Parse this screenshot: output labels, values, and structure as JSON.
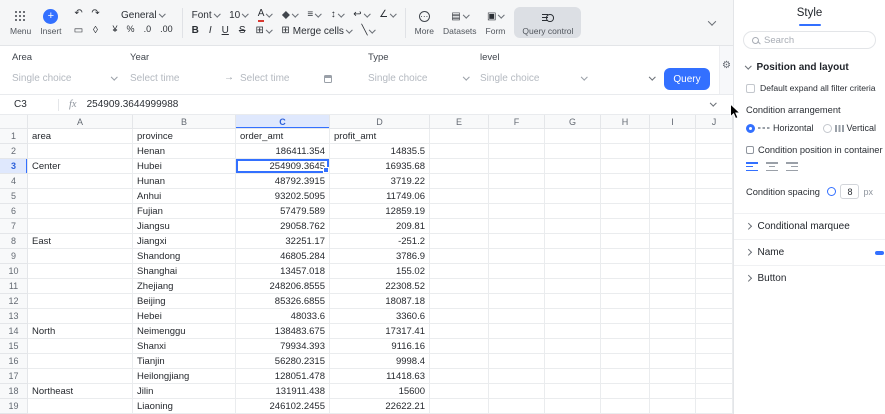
{
  "app": {
    "accent_color": "#3370ff"
  },
  "icons": {
    "undo": "↶",
    "redo": "↷",
    "painter": "▭",
    "eraser": "◊",
    "currency": "¥",
    "percent": "%",
    "decrease_decimal": ".0",
    "increase_decimal": ".00",
    "text_color": "A",
    "bold": "B",
    "italic": "I",
    "underline": "U",
    "strikethrough": "S",
    "borders": "⊞",
    "merge": "⊞",
    "diagonal": "╲",
    "align": "≡",
    "valign": "↕",
    "wrap": "↩",
    "rotate": "∠",
    "more_dots": "⋯",
    "datasets": "▤",
    "form": "▣",
    "range_arrow": "→",
    "gear": "⚙"
  },
  "toolbar": {
    "menu": "Menu",
    "insert": "Insert",
    "number_format": "General",
    "font": "Font",
    "font_size": "10",
    "merge_cells": "Merge cells",
    "more": "More",
    "datasets": "Datasets",
    "form": "Form",
    "query_control": "Query control"
  },
  "filter_bar": {
    "area_label": "Area",
    "area_value": "Single choice",
    "year_label": "Year",
    "year_start": "Select time",
    "year_end": "Select time",
    "type_label": "Type",
    "type_value": "Single choice",
    "level_label": "level",
    "level_value": "Single choice",
    "query_button": "Query"
  },
  "formula_bar": {
    "cell_ref": "C3",
    "fx_label": "fx",
    "value": "254909.3644999988"
  },
  "grid": {
    "col_letters": [
      "A",
      "B",
      "C",
      "D",
      "E",
      "F",
      "G",
      "H",
      "I",
      "J"
    ],
    "selected": {
      "col": "C",
      "row": 3
    },
    "rows": [
      {
        "n": 1,
        "cells": [
          "area",
          "province",
          "order_amt",
          "profit_amt"
        ]
      },
      {
        "n": 2,
        "cells": [
          "",
          "Henan",
          "186411.354",
          "14835.5"
        ]
      },
      {
        "n": 3,
        "cells": [
          "Center",
          "Hubei",
          "254909.3645",
          "16935.68"
        ]
      },
      {
        "n": 4,
        "cells": [
          "",
          "Hunan",
          "48792.3915",
          "3719.22"
        ]
      },
      {
        "n": 5,
        "cells": [
          "",
          "Anhui",
          "93202.5095",
          "11749.06"
        ]
      },
      {
        "n": 6,
        "cells": [
          "",
          "Fujian",
          "57479.589",
          "12859.19"
        ]
      },
      {
        "n": 7,
        "cells": [
          "",
          "Jiangsu",
          "29058.762",
          "209.81"
        ]
      },
      {
        "n": 8,
        "cells": [
          "East",
          "Jiangxi",
          "32251.17",
          "-251.2"
        ]
      },
      {
        "n": 9,
        "cells": [
          "",
          "Shandong",
          "46805.284",
          "3786.9"
        ]
      },
      {
        "n": 10,
        "cells": [
          "",
          "Shanghai",
          "13457.018",
          "155.02"
        ]
      },
      {
        "n": 11,
        "cells": [
          "",
          "Zhejiang",
          "248206.8555",
          "22308.52"
        ]
      },
      {
        "n": 12,
        "cells": [
          "",
          "Beijing",
          "85326.6855",
          "18087.18"
        ]
      },
      {
        "n": 13,
        "cells": [
          "",
          "Hebei",
          "48033.6",
          "3360.6"
        ]
      },
      {
        "n": 14,
        "cells": [
          "North",
          "Neimenggu",
          "138483.675",
          "17317.41"
        ]
      },
      {
        "n": 15,
        "cells": [
          "",
          "Shanxi",
          "79934.393",
          "9116.16"
        ]
      },
      {
        "n": 16,
        "cells": [
          "",
          "Tianjin",
          "56280.2315",
          "9998.4"
        ]
      },
      {
        "n": 17,
        "cells": [
          "",
          "Heilongjiang",
          "128051.478",
          "11418.63"
        ]
      },
      {
        "n": 18,
        "cells": [
          "Northeast",
          "Jilin",
          "131911.438",
          "15600"
        ]
      },
      {
        "n": 19,
        "cells": [
          "",
          "Liaoning",
          "246102.2455",
          "22622.21"
        ]
      }
    ]
  },
  "sidebar": {
    "title": "Style",
    "search_placeholder": "Search",
    "position_layout_section": "Position and layout",
    "default_expand_label": "Default expand all filter criteria",
    "condition_arrangement_label": "Condition arrangement",
    "horizontal_label": "Horizontal",
    "vertical_label": "Vertical",
    "condition_position_label": "Condition position in container",
    "condition_spacing_label": "Condition spacing",
    "spacing_value": "8",
    "spacing_unit": "px",
    "conditional_marquee_section": "Conditional marquee",
    "name_section": "Name",
    "button_section": "Button"
  }
}
